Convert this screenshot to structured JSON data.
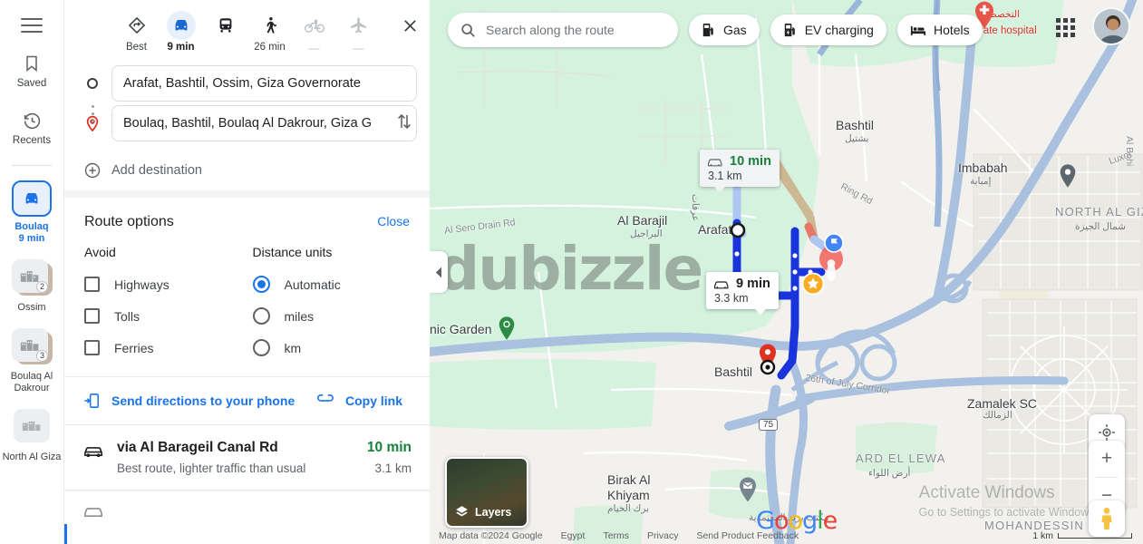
{
  "rail": {
    "menu_icon": "hamburger-icon",
    "items": [
      {
        "label": "Saved",
        "icon": "bookmark-icon"
      },
      {
        "label": "Recents",
        "icon": "history-icon"
      }
    ],
    "destinations": [
      {
        "label": "Boulaq",
        "sublabel": "9 min",
        "icon": "car-icon",
        "active": true,
        "badge": ""
      },
      {
        "label": "Ossim",
        "sublabel": "",
        "icon": "place-thumb",
        "active": false,
        "badge": "2"
      },
      {
        "label": "Boulaq Al Dakrour",
        "sublabel": "",
        "icon": "place-thumb",
        "active": false,
        "badge": "3"
      },
      {
        "label": "North Al Giza",
        "sublabel": "",
        "icon": "place-thumb",
        "active": false,
        "badge": ""
      }
    ]
  },
  "panel": {
    "modes": [
      {
        "name": "best",
        "icon": "best-route-icon",
        "label": "Best",
        "selected": false,
        "dim": false
      },
      {
        "name": "driving",
        "icon": "car-icon",
        "label": "9 min",
        "selected": true,
        "dim": false
      },
      {
        "name": "transit",
        "icon": "train-icon",
        "label": "",
        "selected": false,
        "dim": false
      },
      {
        "name": "walking",
        "icon": "walk-icon",
        "label": "26 min",
        "selected": false,
        "dim": false
      },
      {
        "name": "cycling",
        "icon": "bicycle-icon",
        "label": "—",
        "selected": false,
        "dim": true
      },
      {
        "name": "flights",
        "icon": "plane-icon",
        "label": "—",
        "selected": false,
        "dim": true
      }
    ],
    "close_icon": "close-icon",
    "origin": {
      "value": "Arafat, Bashtil, Ossim, Giza Governorate",
      "placeholder": "Choose starting point",
      "icon": "circle-outline-icon"
    },
    "destination": {
      "value": "Boulaq, Bashtil, Boulaq Al Dakrour, Giza G",
      "placeholder": "Choose destination",
      "icon": "destination-pin-icon"
    },
    "swap_icon": "swap-vertical-icon",
    "add_destination": {
      "label": "Add destination",
      "icon": "plus-circle-icon"
    },
    "route_options": {
      "title": "Route options",
      "close_label": "Close",
      "avoid_title": "Avoid",
      "avoid": [
        {
          "label": "Highways",
          "checked": false
        },
        {
          "label": "Tolls",
          "checked": false
        },
        {
          "label": "Ferries",
          "checked": false
        }
      ],
      "units_title": "Distance units",
      "units": [
        {
          "label": "Automatic",
          "selected": true
        },
        {
          "label": "miles",
          "selected": false
        },
        {
          "label": "km",
          "selected": false
        }
      ]
    },
    "share": {
      "send_label": "Send directions to your phone",
      "send_icon": "send-to-phone-icon",
      "copy_label": "Copy link",
      "copy_icon": "link-icon"
    },
    "routes": [
      {
        "icon": "car-icon",
        "name": "via Al Barageil Canal Rd",
        "description": "Best route, lighter traffic than usual",
        "time": "10 min",
        "distance": "3.1 km"
      }
    ]
  },
  "map": {
    "search": {
      "placeholder": "Search along the route",
      "value": "",
      "icon": "search-icon"
    },
    "chips": [
      {
        "label": "Gas",
        "icon": "gas-pump-icon"
      },
      {
        "label": "EV charging",
        "icon": "ev-charging-icon"
      },
      {
        "label": "Hotels",
        "icon": "hotel-bed-icon"
      }
    ],
    "collapse_icon": "chevron-left-icon",
    "route_bubbles": [
      {
        "name": "alternate-route-bubble",
        "time": "10 min",
        "distance": "3.1 km",
        "style": "alt",
        "icon": "car-icon"
      },
      {
        "name": "selected-route-bubble",
        "time": "9 min",
        "distance": "3.3 km",
        "style": "primary",
        "icon": "car-icon"
      }
    ],
    "labels": [
      {
        "name": "map-label-al-sero-drain-rd",
        "text": "Al Sero Drain Rd",
        "kind": "road"
      },
      {
        "name": "map-label-al-barajil",
        "text": "Al Barajil",
        "kind": "place"
      },
      {
        "name": "map-label-al-barajil-ar",
        "text": "البراجيل",
        "kind": "arabic"
      },
      {
        "name": "map-label-arafat",
        "text": "Arafat",
        "kind": "place"
      },
      {
        "name": "map-label-bashtil-north",
        "text": "Bashtil",
        "kind": "place"
      },
      {
        "name": "map-label-bashtil-north-ar",
        "text": "بشتيل",
        "kind": "arabic"
      },
      {
        "name": "map-label-imbabah",
        "text": "Imbabah",
        "kind": "place"
      },
      {
        "name": "map-label-imbabah-ar",
        "text": "إمبابة",
        "kind": "arabic"
      },
      {
        "name": "map-label-north-al-giza",
        "text": "NORTH AL GIZA",
        "kind": "area"
      },
      {
        "name": "map-label-north-al-giza-ar",
        "text": "شمال الجيزة",
        "kind": "arabic"
      },
      {
        "name": "map-label-luxor",
        "text": "Luxor",
        "kind": "road"
      },
      {
        "name": "map-label-al-bohi",
        "text": "Al Bohi",
        "kind": "road"
      },
      {
        "name": "map-label-ring-rd",
        "text": "Ring Rd",
        "kind": "road"
      },
      {
        "name": "map-label-botanic-garden",
        "text": "nic Garden",
        "kind": "poi"
      },
      {
        "name": "map-label-bashtil-dest",
        "text": "Bashtil",
        "kind": "place"
      },
      {
        "name": "map-label-26th-of-july-corridor",
        "text": "26th of July Corridor",
        "kind": "road"
      },
      {
        "name": "map-label-zamalek-sc",
        "text": "Zamalek SC",
        "kind": "place"
      },
      {
        "name": "map-label-zamalek-sc-ar",
        "text": "الزمالك",
        "kind": "arabic"
      },
      {
        "name": "map-label-ard-el-lewa",
        "text": "ARD EL LEWA",
        "kind": "area"
      },
      {
        "name": "map-label-ard-el-lewa-ar",
        "text": "أرض اللواء",
        "kind": "arabic"
      },
      {
        "name": "map-label-birak-al-khiyam",
        "text": "Birak Al",
        "kind": "place"
      },
      {
        "name": "map-label-birak-al-khiyam-2",
        "text": "Khiyam",
        "kind": "place"
      },
      {
        "name": "map-label-birak-al-khiyam-ar",
        "text": "برك الخيام",
        "kind": "arabic"
      },
      {
        "name": "map-label-mohandessin",
        "text": "MOHANDESSIN",
        "kind": "area"
      },
      {
        "name": "map-label-private-hospital",
        "text": "Private hospital",
        "kind": "hospital"
      },
      {
        "name": "map-label-private-hospital-ar",
        "text": "التخصصي",
        "kind": "arabic"
      },
      {
        "name": "map-label-post-office-ar",
        "text": "مكتب بريد المعتمدية",
        "kind": "arabic"
      },
      {
        "name": "map-label-highway-75",
        "text": "75",
        "kind": "shield"
      },
      {
        "name": "map-label-arafat-ar",
        "text": "عرفات",
        "kind": "arabic"
      }
    ],
    "controls": {
      "my_location_icon": "my-location-icon",
      "zoom_in": "+",
      "zoom_out": "−",
      "pegman_icon": "pegman-icon"
    },
    "layers": {
      "label": "Layers",
      "icon": "layers-icon"
    },
    "google_logo": [
      "G",
      "o",
      "o",
      "g",
      "l",
      "e"
    ],
    "attribution": {
      "map_data": "Map data ©2024 Google",
      "links": [
        "Egypt",
        "Terms",
        "Privacy",
        "Send Product Feedback"
      ],
      "scale": "1 km"
    },
    "watermarks": {
      "dubizzle": "dubizzle",
      "windows_line1": "Activate Windows",
      "windows_line2": "Go to Settings to activate Windows."
    },
    "account": {
      "apps_icon": "apps-grid-icon",
      "avatar_icon": "user-avatar"
    }
  },
  "colors": {
    "accent_blue": "#1a73e8",
    "route_blue": "#1a3ee8",
    "green_text": "#188038",
    "map_green": "#d5f2df",
    "map_land": "#f2f1ee",
    "water_road": "#8fabd4"
  }
}
